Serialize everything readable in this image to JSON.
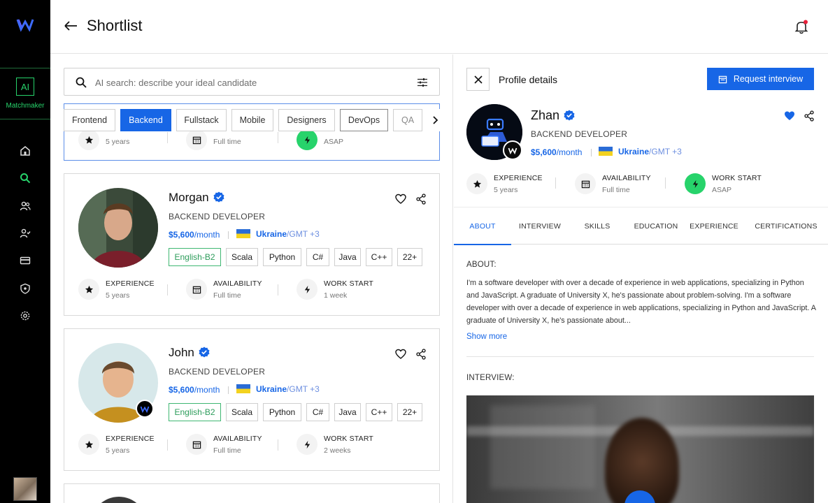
{
  "header": {
    "title": "Shortlist"
  },
  "rail": {
    "matchmaker_ai": "AI",
    "matchmaker_label": "Matchmaker",
    "logo_text": "W"
  },
  "search": {
    "placeholder": "AI search: describe your ideal candidate"
  },
  "filters": [
    "Frontend",
    "Backend",
    "Fullstack",
    "Mobile",
    "Designers",
    "DevOps",
    "QA"
  ],
  "active_filter": "Backend",
  "top_card": {
    "stats": [
      {
        "label": "",
        "value": "5 years"
      },
      {
        "label": "",
        "value": "Full time"
      },
      {
        "label": "",
        "value": "ASAP"
      }
    ]
  },
  "candidates": [
    {
      "name": "Morgan",
      "role": "BACKEND DEVELOPER",
      "salary": "$5,600",
      "period": "/month",
      "country": "Ukraine",
      "timezone": "/GMT +3",
      "skills": [
        "English-B2",
        "Scala",
        "Python",
        "C#",
        "Java",
        "C++",
        "22+"
      ],
      "stats": [
        {
          "label": "EXPERIENCE",
          "value": "5 years"
        },
        {
          "label": "AVAILABILITY",
          "value": "Full time"
        },
        {
          "label": "WORK START",
          "value": "1 week"
        }
      ]
    },
    {
      "name": "John",
      "role": "BACKEND DEVELOPER",
      "salary": "$5,600",
      "period": "/month",
      "country": "Ukraine",
      "timezone": "/GMT +3",
      "skills": [
        "English-B2",
        "Scala",
        "Python",
        "C#",
        "Java",
        "C++",
        "22+"
      ],
      "stats": [
        {
          "label": "EXPERIENCE",
          "value": "5 years"
        },
        {
          "label": "AVAILABILITY",
          "value": "Full time"
        },
        {
          "label": "WORK START",
          "value": "2 weeks"
        }
      ]
    }
  ],
  "detail": {
    "title": "Profile details",
    "request_button": "Request interview",
    "name": "Zhan",
    "role": "BACKEND DEVELOPER",
    "salary": "$5,600",
    "period": "/month",
    "country": "Ukraine",
    "timezone": "/GMT +3",
    "stats": [
      {
        "label": "EXPERIENCE",
        "value": "5 years"
      },
      {
        "label": "AVAILABILITY",
        "value": "Full time"
      },
      {
        "label": "WORK START",
        "value": "ASAP"
      }
    ],
    "tabs": [
      "ABOUT",
      "INTERVIEW",
      "SKILLS",
      "EDUCATION",
      "EXPERIENCE",
      "CERTIFICATIONS"
    ],
    "active_tab": "ABOUT",
    "about_heading": "ABOUT:",
    "about_text": "I'm a software developer with over a decade of experience in web applications, specializing in Python and JavaScript. A graduate of University X, he's passionate about problem-solving. I'm a software developer with over a decade of experience in web applications, specializing in Python and JavaScript. A graduate of University X, he's passionate about...",
    "show_more": "Show more",
    "interview_heading": "INTERVIEW:"
  },
  "colors": {
    "accent": "#1766e6",
    "green": "#27d36b",
    "rail": "#000000"
  }
}
